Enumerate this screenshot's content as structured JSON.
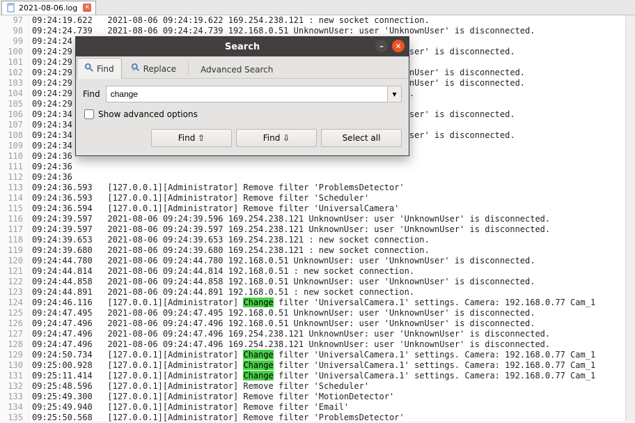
{
  "tab": {
    "filename": "2021-08-06.log"
  },
  "search": {
    "title": "Search",
    "tabs": {
      "find": "Find",
      "replace": "Replace",
      "advanced": "Advanced Search"
    },
    "find_label": "Find",
    "find_value": "change",
    "show_adv_label": "Show advanced options",
    "buttons": {
      "find_prev": "Find ⇧",
      "find_next": "Find ⇩",
      "select_all": "Select all"
    }
  },
  "highlight_word": "Change",
  "lines": [
    {
      "n": 97,
      "text": "09:24:19.622   2021-08-06 09:24:19.622 169.254.238.121 : new socket connection."
    },
    {
      "n": 98,
      "text": "09:24:24.739   2021-08-06 09:24:24.739 192.168.0.51 UnknownUser: user 'UnknownUser' is disconnected."
    },
    {
      "n": 99,
      "text": "09:24:24"
    },
    {
      "n": 100,
      "text": "09:24:29                                                                 nUser' is disconnected."
    },
    {
      "n": 101,
      "text": "09:24:29"
    },
    {
      "n": 102,
      "text": "09:24:29                                                                 ownUser' is disconnected."
    },
    {
      "n": 103,
      "text": "09:24:29                                                                 ownUser' is disconnected."
    },
    {
      "n": 104,
      "text": "09:24:29                                                                 on."
    },
    {
      "n": 105,
      "text": "09:24:29                                                                 n."
    },
    {
      "n": 106,
      "text": "09:24:34                                                                 nUser' is disconnected."
    },
    {
      "n": 107,
      "text": "09:24:34"
    },
    {
      "n": 108,
      "text": "09:24:34                                                                 nUser' is disconnected."
    },
    {
      "n": 109,
      "text": "09:24:34"
    },
    {
      "n": 110,
      "text": "09:24:36"
    },
    {
      "n": 111,
      "text": "09:24:36"
    },
    {
      "n": 112,
      "text": "09:24:36"
    },
    {
      "n": 113,
      "text": "09:24:36.593   [127.0.0.1][Administrator] Remove filter 'ProblemsDetector'"
    },
    {
      "n": 114,
      "text": "09:24:36.593   [127.0.0.1][Administrator] Remove filter 'Scheduler'"
    },
    {
      "n": 115,
      "text": "09:24:36.594   [127.0.0.1][Administrator] Remove filter 'UniversalCamera'"
    },
    {
      "n": 116,
      "text": "09:24:39.597   2021-08-06 09:24:39.596 169.254.238.121 UnknownUser: user 'UnknownUser' is disconnected."
    },
    {
      "n": 117,
      "text": "09:24:39.597   2021-08-06 09:24:39.597 169.254.238.121 UnknownUser: user 'UnknownUser' is disconnected."
    },
    {
      "n": 118,
      "text": "09:24:39.653   2021-08-06 09:24:39.653 169.254.238.121 : new socket connection."
    },
    {
      "n": 119,
      "text": "09:24:39.680   2021-08-06 09:24:39.680 169.254.238.121 : new socket connection."
    },
    {
      "n": 120,
      "text": "09:24:44.780   2021-08-06 09:24:44.780 192.168.0.51 UnknownUser: user 'UnknownUser' is disconnected."
    },
    {
      "n": 121,
      "text": "09:24:44.814   2021-08-06 09:24:44.814 192.168.0.51 : new socket connection."
    },
    {
      "n": 122,
      "text": "09:24:44.858   2021-08-06 09:24:44.858 192.168.0.51 UnknownUser: user 'UnknownUser' is disconnected."
    },
    {
      "n": 123,
      "text": "09:24:44.891   2021-08-06 09:24:44.891 192.168.0.51 : new socket connection."
    },
    {
      "n": 124,
      "text": "09:24:46.116   [127.0.0.1][Administrator] Change filter 'UniversalCamera.1' settings. Camera: 192.168.0.77 Cam_1"
    },
    {
      "n": 125,
      "text": "09:24:47.495   2021-08-06 09:24:47.495 192.168.0.51 UnknownUser: user 'UnknownUser' is disconnected."
    },
    {
      "n": 126,
      "text": "09:24:47.496   2021-08-06 09:24:47.496 192.168.0.51 UnknownUser: user 'UnknownUser' is disconnected."
    },
    {
      "n": 127,
      "text": "09:24:47.496   2021-08-06 09:24:47.496 169.254.238.121 UnknownUser: user 'UnknownUser' is disconnected."
    },
    {
      "n": 128,
      "text": "09:24:47.496   2021-08-06 09:24:47.496 169.254.238.121 UnknownUser: user 'UnknownUser' is disconnected."
    },
    {
      "n": 129,
      "text": "09:24:50.734   [127.0.0.1][Administrator] Change filter 'UniversalCamera.1' settings. Camera: 192.168.0.77 Cam_1"
    },
    {
      "n": 130,
      "text": "09:25:00.928   [127.0.0.1][Administrator] Change filter 'UniversalCamera.1' settings. Camera: 192.168.0.77 Cam_1"
    },
    {
      "n": 131,
      "text": "09:25:11.414   [127.0.0.1][Administrator] Change filter 'UniversalCamera.1' settings. Camera: 192.168.0.77 Cam_1"
    },
    {
      "n": 132,
      "text": "09:25:48.596   [127.0.0.1][Administrator] Remove filter 'Scheduler'"
    },
    {
      "n": 133,
      "text": "09:25:49.300   [127.0.0.1][Administrator] Remove filter 'MotionDetector'"
    },
    {
      "n": 134,
      "text": "09:25:49.940   [127.0.0.1][Administrator] Remove filter 'Email'"
    },
    {
      "n": 135,
      "text": "09:25:50.568   [127.0.0.1][Administrator] Remove filter 'ProblemsDetector'"
    }
  ]
}
